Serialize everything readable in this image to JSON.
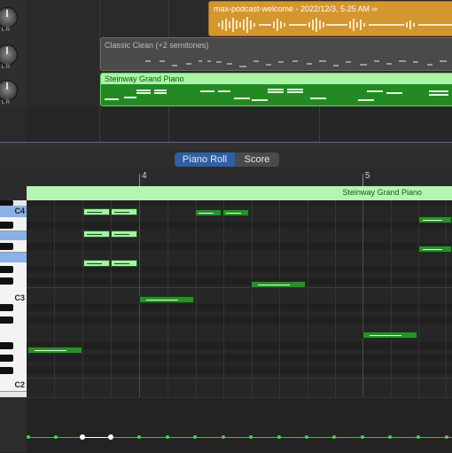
{
  "arrange": {
    "tracks": [
      {
        "knob_label": "L  R"
      },
      {
        "knob_label": "L  R"
      },
      {
        "knob_label": "L  R"
      }
    ],
    "audio_region": {
      "title": "max-podcast-welcome - 2022/12/3, 5.25 AM",
      "icon": "loop-icon"
    },
    "midi_region_gray": {
      "title": "Classic Clean (+2 semitones)"
    },
    "midi_region_green": {
      "title": "Steinway Grand Piano"
    }
  },
  "editor": {
    "tabs": [
      {
        "label": "Piano Roll",
        "active": true
      },
      {
        "label": "Score",
        "active": false
      }
    ],
    "ruler": {
      "bar_4": "4",
      "bar_5": "5"
    },
    "region_name": "Steinway Grand Piano",
    "keys": {
      "c4": "C4",
      "c3": "C3",
      "c2": "C2"
    }
  },
  "colors": {
    "accent_blue": "#2f5fa6",
    "note_green": "#2a8f2a",
    "region_green": "#b2f6b2",
    "audio_orange": "#d4962e"
  }
}
